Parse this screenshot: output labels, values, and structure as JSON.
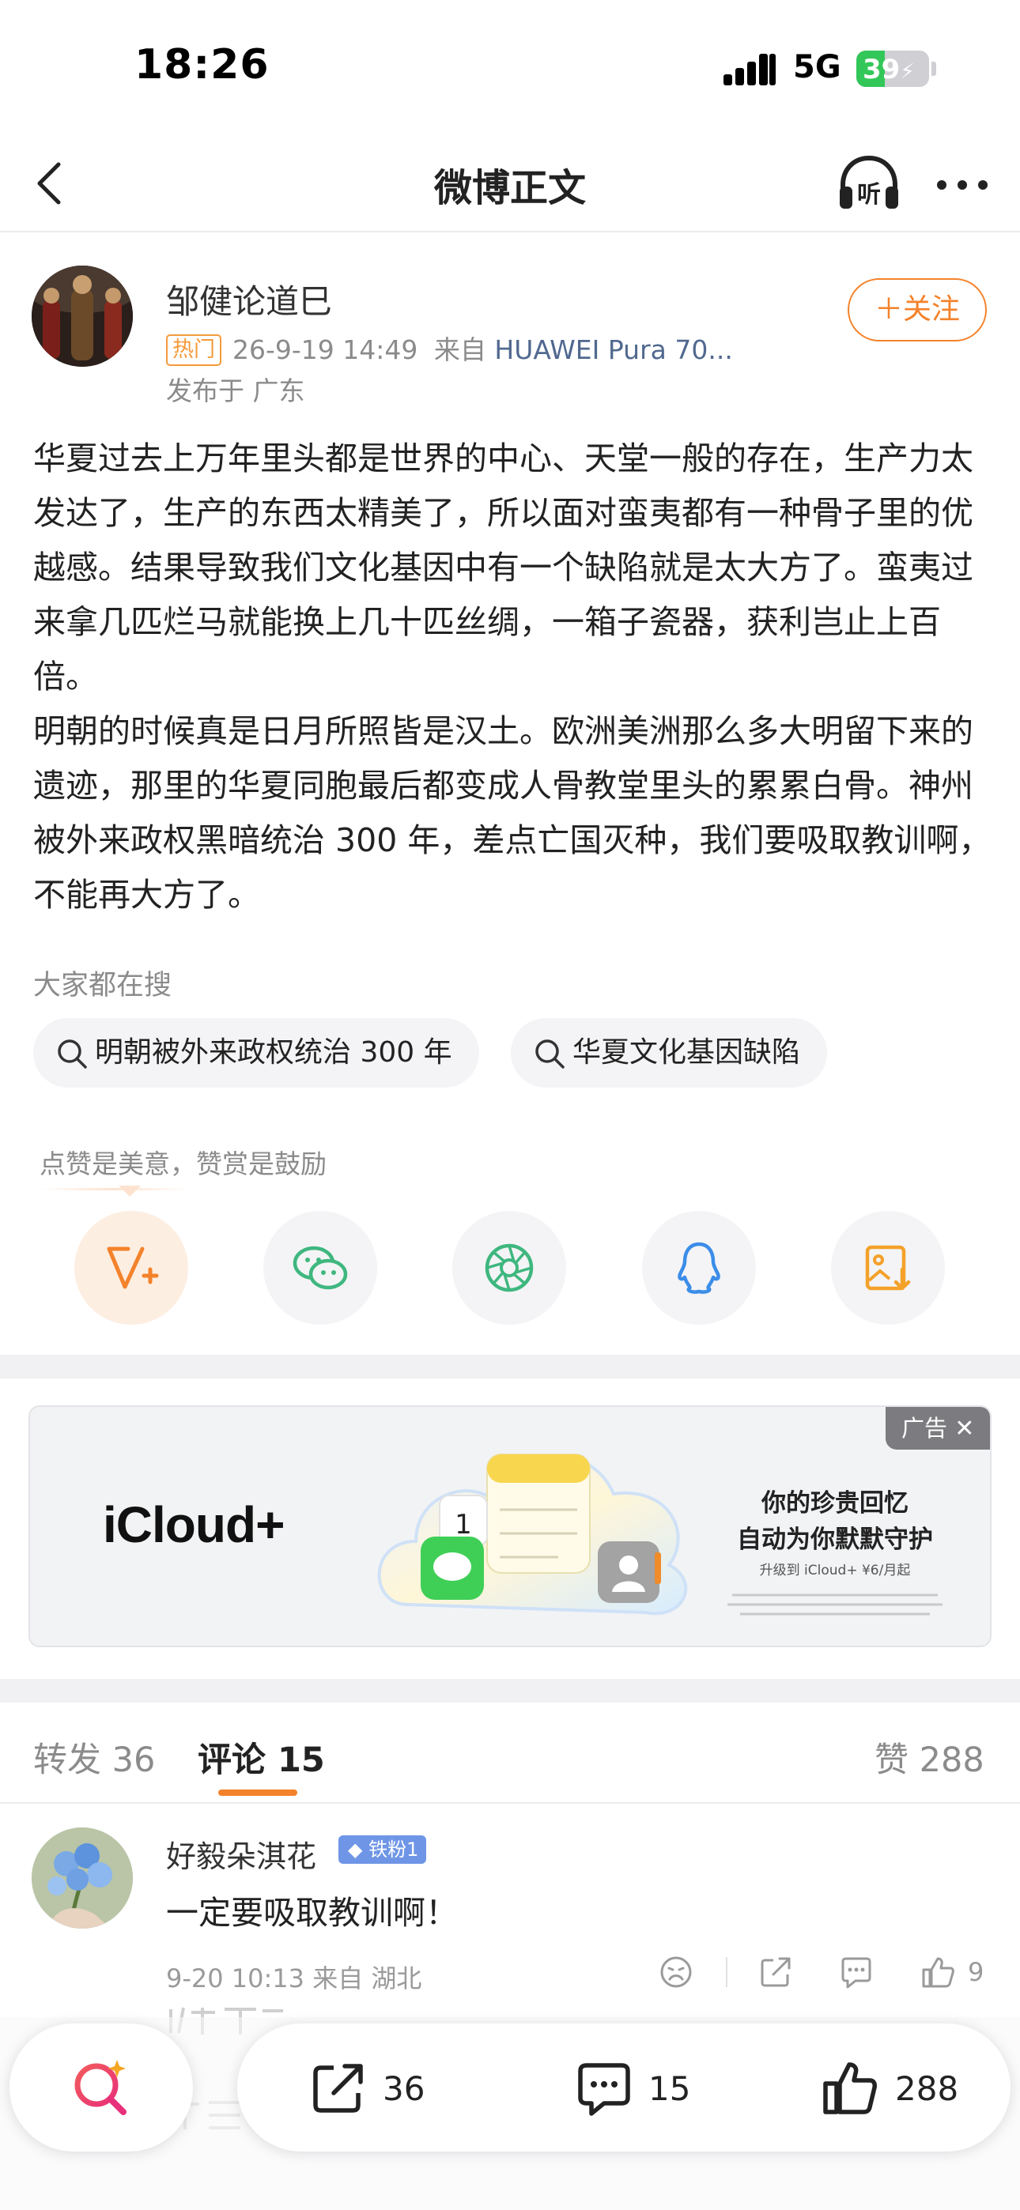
{
  "status_bar": {
    "time": "18:26",
    "network": "5G",
    "battery": "39",
    "battery_level": 0.39
  },
  "nav": {
    "title": "微博正文",
    "listen_icon": "headphones-icon",
    "more_icon": "more-icon"
  },
  "post": {
    "author": "邹健论道巳",
    "hot_badge": "热门",
    "datetime": "26-9-19 14:49",
    "source_prefix": "来自",
    "device": "HUAWEI Pura 70...",
    "location": "发布于 广东",
    "follow_label": "＋关注",
    "paragraphs": [
      "华夏过去上万年里头都是世界的中心、天堂一般的存在，生产力太发达了，生产的东西太精美了，所以面对蛮夷都有一种骨子里的优越感。结果导致我们文化基因中有一个缺陷就是太大方了。蛮夷过来拿几匹烂马就能换上几十匹丝绸，一箱子瓷器，获利岂止上百倍。",
      "明朝的时候真是日月所照皆是汉土。欧洲美洲那么多大明留下来的遗迹，那里的华夏同胞最后都变成人骨教堂里头的累累白骨。神州被外来政权黑暗统治 300 年，差点亡国灭种，我们要吸取教训啊，不能再大方了。"
    ]
  },
  "search": {
    "heading": "大家都在搜",
    "chips": [
      "明朝被外来政权统治 300 年",
      "华夏文化基因缺陷"
    ]
  },
  "share": {
    "hint": "点赞是美意，赞赏是鼓励",
    "icons": [
      "reward-icon",
      "wechat-icon",
      "moments-icon",
      "qq-icon",
      "save-image-icon"
    ]
  },
  "ad": {
    "label": "广告",
    "brand": "iCloud+",
    "headline_1": "你的珍贵回忆",
    "headline_2": "自动为你默默守护",
    "sub": "升级到 iCloud+ ¥6/月起"
  },
  "tabs": {
    "repost": "转发 36",
    "comment": "评论 15",
    "like": "赞 288"
  },
  "comment": {
    "user": "好毅朵淇花",
    "badge": "铁粉1",
    "text": "一定要吸取教训啊！",
    "meta": "9-20 10:13 来自 湖北",
    "likes": "9"
  },
  "bottom_bar": {
    "repost_count": "36",
    "comment_count": "15",
    "like_count": "288"
  },
  "colors": {
    "accent": "#f4822a",
    "link": "#51698f",
    "battery": "#33c759"
  }
}
